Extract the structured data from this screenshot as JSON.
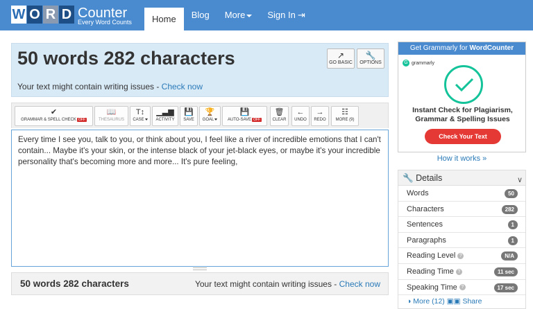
{
  "logo": {
    "letters": [
      "W",
      "O",
      "R",
      "D"
    ],
    "name": "Counter",
    "tagline": "Every Word Counts"
  },
  "nav": {
    "home": "Home",
    "blog": "Blog",
    "more": "More",
    "signin": "Sign In"
  },
  "header": {
    "title": "50 words 282 characters",
    "issues_text": "Your text might contain writing issues - ",
    "issues_link": "Check now",
    "go_basic": "GO BASIC",
    "options": "OPTIONS"
  },
  "toolbar": {
    "grammar": "GRAMMAR & SPELL CHECK",
    "grammar_badge": "OFF",
    "thesaurus": "THESAURUS",
    "case": "CASE",
    "activity": "ACTIVITY",
    "save": "SAVE",
    "goal": "GOAL",
    "autosave": "AUTO-SAVE",
    "autosave_badge": "OFF",
    "clear": "CLEAR",
    "undo": "UNDO",
    "redo": "REDO",
    "more": "MORE (9)"
  },
  "editor": {
    "text": "Every time I see you, talk to you, or think about you, I feel like a river of incredible emotions that I can't contain... Maybe it's your skin, or the intense black of your jet-black eyes, or maybe it's your incredible personality that's becoming more and more... It's pure feeling,"
  },
  "footer": {
    "count": "50 words 282 characters",
    "issues_text": "Your text might contain writing issues - ",
    "issues_link": "Check now"
  },
  "ad": {
    "head_prefix": "Get Grammarly for ",
    "head_bold": "WordCounter",
    "brand": "grammarly",
    "line1": "Instant Check for Plagiarism,",
    "line2": "Grammar & Spelling Issues",
    "button": "Check Your Text"
  },
  "how_it_works": "How it works »",
  "details": {
    "title": "Details",
    "rows": [
      {
        "label": "Words",
        "value": "50"
      },
      {
        "label": "Characters",
        "value": "282"
      },
      {
        "label": "Sentences",
        "value": "1"
      },
      {
        "label": "Paragraphs",
        "value": "1"
      },
      {
        "label": "Reading Level",
        "value": "N/A"
      },
      {
        "label": "Reading Time",
        "value": "11 sec"
      },
      {
        "label": "Speaking Time",
        "value": "17 sec"
      }
    ],
    "more": "More (12)",
    "share": "Share"
  },
  "colors": {
    "nav": "#4a8bd0",
    "panel": "#d9eaf7",
    "link": "#2a7ab8",
    "grammarly": "#15c39a",
    "cta": "#e53935"
  }
}
